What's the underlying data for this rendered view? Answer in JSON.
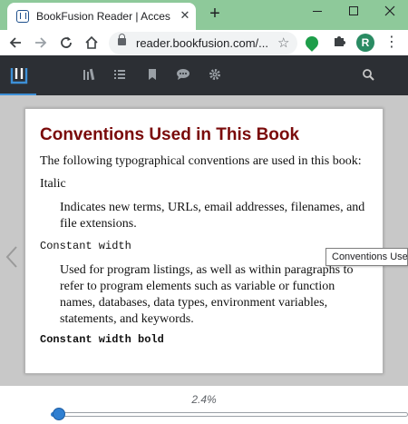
{
  "browser": {
    "tab_title": "BookFusion Reader | Accessible E",
    "tab_close": "✕",
    "new_tab": "+",
    "url": "reader.bookfusion.com/...",
    "profile_initial": "R",
    "window_buttons": [
      "minimize",
      "maximize",
      "close"
    ]
  },
  "app_toolbar": {
    "icons": [
      "logo-icon",
      "library-icon",
      "list-icon",
      "bookmark-icon",
      "chat-icon",
      "settings-icon",
      "search-icon"
    ]
  },
  "document": {
    "title": "Conventions Used in This Book",
    "intro": "The following typographical conventions are used in this book:",
    "entries": [
      {
        "term": "Italic",
        "definition": "Indicates new terms, URLs, email addresses, filenames, and file extensions."
      },
      {
        "term": "Constant width",
        "definition": "Used for program listings, as well as within paragraphs to refer to program elements such as variable or function names, databases, data types, environment variables, statements, and keywords."
      },
      {
        "term": "Constant width bold",
        "definition": ""
      }
    ]
  },
  "tooltip": "Conventions Used",
  "progress": {
    "label": "2.4%",
    "value": 0.024
  },
  "colors": {
    "tab_strip": "#8ec99a",
    "app_bar": "#2c2f34",
    "title_red": "#7a0a0a",
    "slider_blue": "#2f7fd1",
    "reader_bg": "#c8c8c8"
  }
}
